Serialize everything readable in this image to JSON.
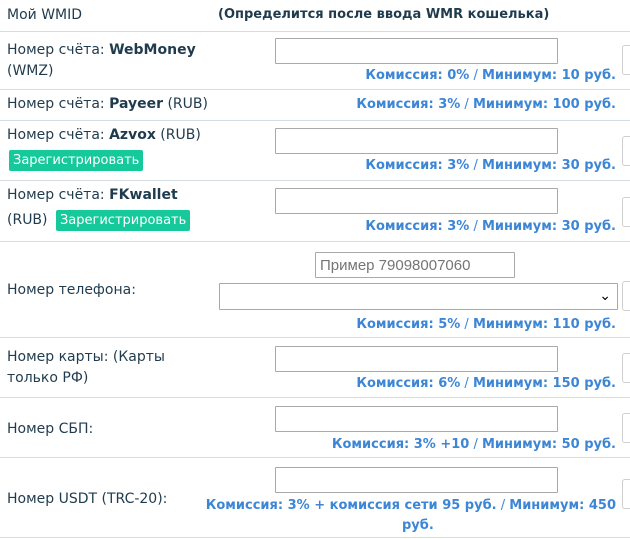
{
  "header": {
    "label": "Мой WMID",
    "note": "(Определится после ввода WMR кошелька)"
  },
  "rows": {
    "webmoney": {
      "label_prefix": "Номер счёта: ",
      "label_bold": "WebMoney",
      "label_suffix": "(WMZ)",
      "fee_text": "Комиссия: 0%",
      "min_text": "Минимум: 10 руб."
    },
    "payeer": {
      "label_prefix": "Номер счёта: ",
      "label_bold": "Payeer",
      "label_suffix": " (RUB)",
      "fee_text": "Комиссия: 3%",
      "min_text": "Минимум: 100 руб."
    },
    "azvox": {
      "label_prefix": "Номер счёта: ",
      "label_bold": "Azvox",
      "label_suffix": " (RUB)",
      "register_label": "Зарегистрировать",
      "fee_text": "Комиссия: 3%",
      "min_text": "Минимум: 30 руб."
    },
    "fkwallet": {
      "label_prefix": "Номер счёта: ",
      "label_bold": "FKwallet",
      "label_suffix": "(RUB)",
      "register_label": "Зарегистрировать",
      "fee_text": "Комиссия: 3%",
      "min_text": "Минимум: 30 руб."
    },
    "phone": {
      "label": "Номер телефона:",
      "placeholder": "Пример 79098007060",
      "fee_text": "Комиссия: 5%",
      "min_text": "Минимум: 110 руб."
    },
    "card": {
      "label_line1": "Номер карты: (Карты",
      "label_line2": "только РФ)",
      "fee_text": "Комиссия: 6%",
      "min_text": "Минимум: 150 руб."
    },
    "sbp": {
      "label": "Номер СБП:",
      "fee_text": "Комиссия: 3% +10",
      "min_text": "Минимум: 50 руб."
    },
    "usdt": {
      "label": "Номер USDT (TRC-20):",
      "fee_text": "Комиссия: 3% + комиссия сети 95 руб.",
      "min_text_line1": "Минимум: 450",
      "min_text_line2": "руб."
    }
  },
  "separator": " / ",
  "colors": {
    "text": "#1f3b4d",
    "fee": "#3d86d6",
    "register_button": "#15c99b",
    "border": "#d6dde2"
  }
}
